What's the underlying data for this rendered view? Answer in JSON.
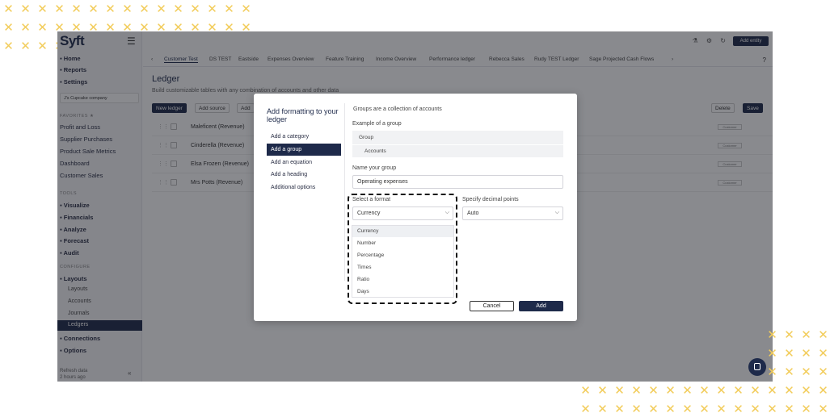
{
  "app": {
    "logo": "Syft",
    "add_entity": "Add entity",
    "company": "J's Cupcake company",
    "refresh_label": "Refresh data",
    "refresh_time": "2 hours ago"
  },
  "sidebar": {
    "top_items": [
      "Home",
      "Reports",
      "Settings"
    ],
    "favourites_label": "FAVORITES ★",
    "favourites": [
      "Profit and Loss",
      "Supplier Purchases",
      "Product Sale Metrics",
      "Dashboard",
      "Customer Sales"
    ],
    "tools_label": "TOOLS",
    "tools": [
      "Visualize",
      "Financials",
      "Analyze",
      "Forecast",
      "Audit"
    ],
    "configure_label": "CONFIGURE",
    "layouts": "Layouts",
    "layouts_sub": [
      "Layouts",
      "Accounts",
      "Journals",
      "Ledgers"
    ],
    "connections": "Connections",
    "options": "Options"
  },
  "tabs": [
    "Customer Test",
    "DS TEST",
    "Eastside",
    "Expenses Overview",
    "Feature Training",
    "Income Overview",
    "Performance ledger",
    "Rebecca Sales",
    "Rudy TEST Ledger",
    "Sage Projected Cash Flows"
  ],
  "ledger": {
    "title": "Ledger",
    "subtitle": "Build customizable tables with any combination of accounts and other data",
    "new_ledger": "New ledger",
    "add_source": "Add source",
    "add_other": "Add",
    "delete": "Delete",
    "save": "Save",
    "rows": [
      "Maleficent (Revenue)",
      "Cinderella (Revenue)",
      "Elsa Frozen (Revenue)",
      "Mrs Potts (Revenue)"
    ],
    "row_tag": "Customer"
  },
  "modal": {
    "title": "Add formatting to your ledger",
    "nav": [
      "Add a category",
      "Add a group",
      "Add an equation",
      "Add a heading",
      "Additional options"
    ],
    "intro": "Groups are a collection of accounts",
    "example_label": "Example of a group",
    "example_group": "Group",
    "example_accounts": "Accounts",
    "name_label": "Name your group",
    "name_value": "Operating expenses",
    "format_label": "Select a format",
    "format_value": "Currency",
    "decimal_label": "Specify decimal points",
    "decimal_value": "Auto",
    "format_options": [
      "Currency",
      "Number",
      "Percentage",
      "Times",
      "Ratio",
      "Days"
    ],
    "cancel": "Cancel",
    "add": "Add"
  },
  "colors": {
    "accent": "#1e2a4a",
    "crosses": "#f2cc5a"
  }
}
